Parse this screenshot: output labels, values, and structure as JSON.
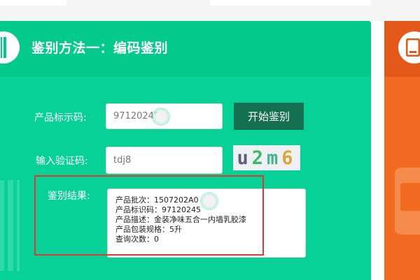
{
  "panel": {
    "title": "鉴别方法一：编码鉴别",
    "icon": "barcode-icon"
  },
  "form": {
    "product_code": {
      "label": "产品标示码:",
      "value": "97120245"
    },
    "start_button": "开始鉴别",
    "verify_code": {
      "label": "输入验证码:",
      "value": "tdj8"
    },
    "captcha": {
      "char1": "u",
      "char2": "2",
      "char3": "m",
      "char4": "6"
    },
    "result": {
      "label": "鉴别结果:",
      "lines": [
        "产品批次：1507202A0",
        "产品标识码：97120245",
        "产品描述：金装净味五合一内墙乳胶漆",
        "产品包装规格：5升",
        "查询次数：0"
      ]
    }
  },
  "side_panel": {
    "icon": "phone-icon"
  },
  "colors": {
    "panel_green": "#07d197",
    "header_green": "#03c98b",
    "button_dark_green": "#156f51",
    "highlight_red": "#dc3b32",
    "side_orange": "#f06a1f"
  }
}
